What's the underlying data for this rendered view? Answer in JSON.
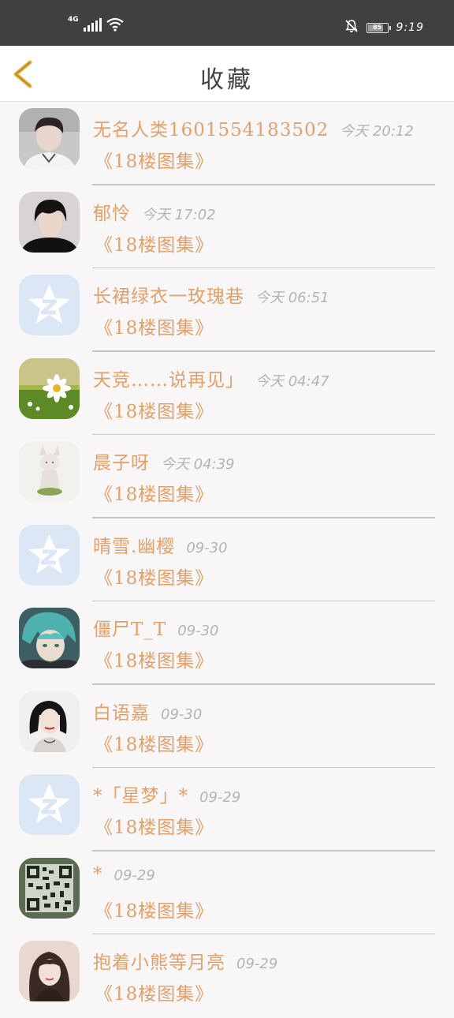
{
  "status_bar": {
    "network": "4G",
    "clock": "9:19",
    "battery_level": "85"
  },
  "nav": {
    "title": "收藏"
  },
  "items": [
    {
      "name": "无名人类1601554183502",
      "time": "今天 20:12",
      "subtitle": "《18楼图集》",
      "avatar": "photo-boy-white-shirt"
    },
    {
      "name": "郁怜",
      "time": "今天 17:02",
      "subtitle": "《18楼图集》",
      "avatar": "photo-boy-black-hair"
    },
    {
      "name": "长裙绿衣一玫瑰巷",
      "time": "今天 06:51",
      "subtitle": "《18楼图集》",
      "avatar": "qq-default-avatar"
    },
    {
      "name": "天竞……说再见」",
      "time": "今天 04:47",
      "subtitle": "《18楼图集》",
      "avatar": "daisy-field"
    },
    {
      "name": "晨子呀",
      "time": "今天 04:39",
      "subtitle": "《18楼图集》",
      "avatar": "anime-fox-girl"
    },
    {
      "name": "晴雪.幽樱",
      "time": "09-30",
      "subtitle": "《18楼图集》",
      "avatar": "qq-default-avatar"
    },
    {
      "name": "僵尸T_T",
      "time": "09-30",
      "subtitle": "《18楼图集》",
      "avatar": "anime-teal-hair"
    },
    {
      "name": "白语嘉",
      "time": "09-30",
      "subtitle": "《18楼图集》",
      "avatar": "photo-girl-bob"
    },
    {
      "name": "*「星梦」*",
      "time": "09-29",
      "subtitle": "《18楼图集》",
      "avatar": "qq-default-avatar"
    },
    {
      "name": "*",
      "time": "09-29",
      "subtitle": "《18楼图集》",
      "avatar": "qr-code"
    },
    {
      "name": "抱着小熊等月亮",
      "time": "09-29",
      "subtitle": "《18楼图集》",
      "avatar": "photo-girl-long-hair"
    }
  ],
  "colors": {
    "accent": "#e2a06a",
    "time_gray": "#b7b3b5",
    "status_bar": "#404040",
    "back_arrow": "#e6b33a"
  }
}
